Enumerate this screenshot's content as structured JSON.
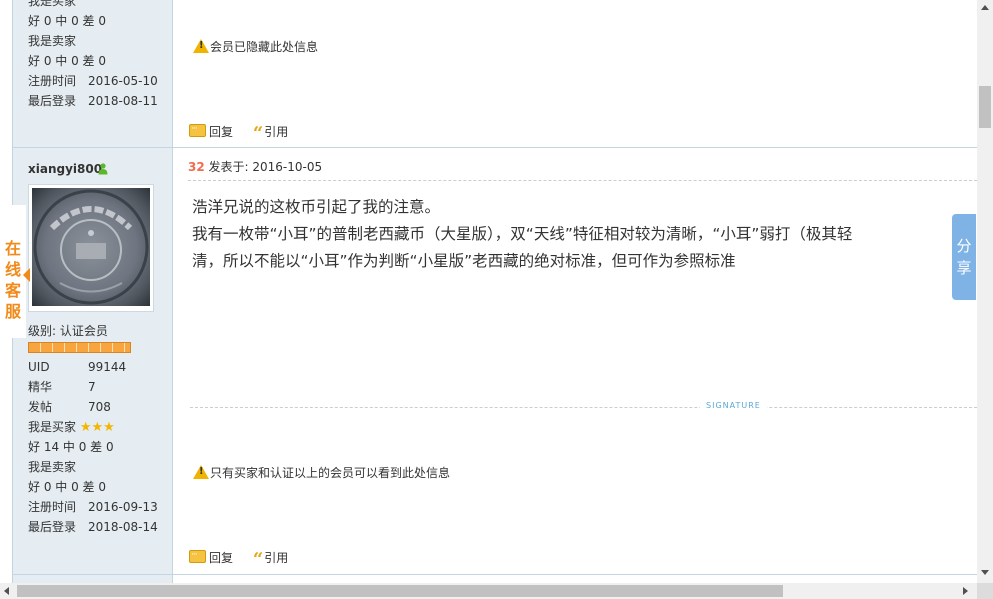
{
  "prev_post": {
    "stats": [
      {
        "label": "我是买家",
        "value": ""
      },
      {
        "label": "好 0 中 0 差 0",
        "value": ""
      },
      {
        "label": "我是卖家",
        "value": ""
      },
      {
        "label": "好 0 中 0 差 0",
        "value": ""
      },
      {
        "label": "注册时间",
        "value": "2016-05-10"
      },
      {
        "label": "最后登录",
        "value": "2018-08-11"
      }
    ],
    "notice": "会员已隐藏此处信息",
    "reply_label": "回复",
    "quote_label": "引用"
  },
  "post": {
    "username": "xiangyi800",
    "online_icon": "online-user-icon",
    "level_label": "级别: 认证会员",
    "stats": [
      {
        "label": "UID",
        "value": "99144"
      },
      {
        "label": "精华",
        "value": "7"
      },
      {
        "label": "发帖",
        "value": "708"
      }
    ],
    "buyer_label": "我是买家",
    "buyer_stars": 3,
    "buyer_rating": "好 14 中 0 差 0",
    "seller_label": "我是卖家",
    "seller_rating": "好 0 中 0 差 0",
    "register_label": "注册时间",
    "register_date": "2016-09-13",
    "lastlogin_label": "最后登录",
    "lastlogin_date": "2018-08-14",
    "floor": "32",
    "posted_label": " 发表于: 2016-10-05",
    "content_lines": [
      "浩洋兄说的这枚币引起了我的注意。",
      "我有一枚带“小耳”的普制老西藏币（大星版），双“天线”特征相对较为清晰，“小耳”弱打（极其轻",
      "清，所以不能以“小耳”作为判断“小星版”老西藏的绝对标准，但可作为参照标准"
    ],
    "signature_label": "SIGNATURE",
    "notice": "只有买家和认证以上的会员可以看到此处信息",
    "reply_label": "回复",
    "quote_label": "引用"
  },
  "float": {
    "service_label": "在线客服",
    "share_label": "分享"
  },
  "colors": {
    "sidebar_bg": "#e5edf2",
    "border": "#c2d5e3",
    "floor": "#f26c4f",
    "service": "#f28a1a",
    "share": "#7fb3e6"
  }
}
